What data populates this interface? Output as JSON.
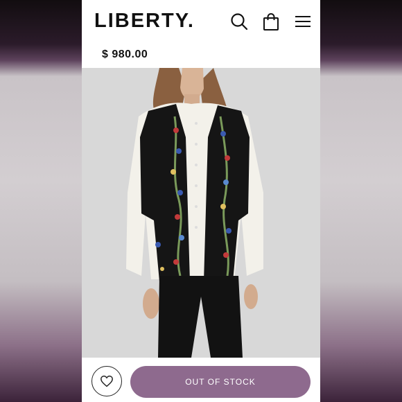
{
  "header": {
    "logo_text": "LIBERTY.",
    "icons": [
      "search-icon",
      "shopping-bag-icon",
      "menu-icon"
    ]
  },
  "product": {
    "price": "$ 980.00",
    "image_description": "Model wearing black embroidered floral vest over white blouse and black velvet trousers"
  },
  "actions": {
    "wishlist_icon": "heart-icon",
    "cta_label": "OUT OF STOCK"
  },
  "colors": {
    "cta_background": "#8e6a8e",
    "text": "#111111"
  }
}
